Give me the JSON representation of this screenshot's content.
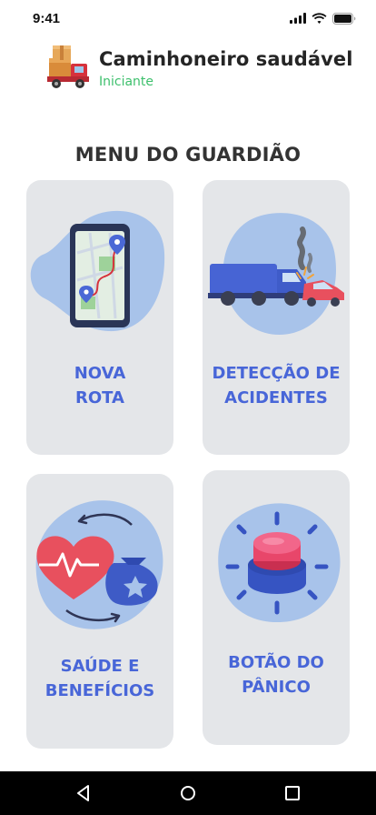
{
  "status_bar": {
    "time": "9:41",
    "icons": [
      "signal-icon",
      "wifi-icon",
      "battery-icon"
    ]
  },
  "header": {
    "logo": "delivery-truck-logo",
    "title": "Caminhoneiro saudável",
    "level": "Iniciante"
  },
  "menu": {
    "title": "MENU DO GUARDIÃO",
    "cards": [
      {
        "line1": "NOVA",
        "line2": "ROTA",
        "icon": "map-route-icon"
      },
      {
        "line1": "DETECÇÃO DE",
        "line2": "ACIDENTES",
        "icon": "truck-crash-icon"
      },
      {
        "line1": "SAÚDE E",
        "line2": "BENEFÍCIOS",
        "icon": "heart-money-icon"
      },
      {
        "line1": "BOTÃO DO",
        "line2": "PÂNICO",
        "icon": "panic-button-icon"
      }
    ]
  },
  "nav": {
    "buttons": [
      "back-icon",
      "home-icon",
      "recents-icon"
    ]
  },
  "colors": {
    "card_bg": "#e4e6e9",
    "label": "#4866d8",
    "level": "#3ec06d",
    "blob": "#a8c3ea"
  }
}
